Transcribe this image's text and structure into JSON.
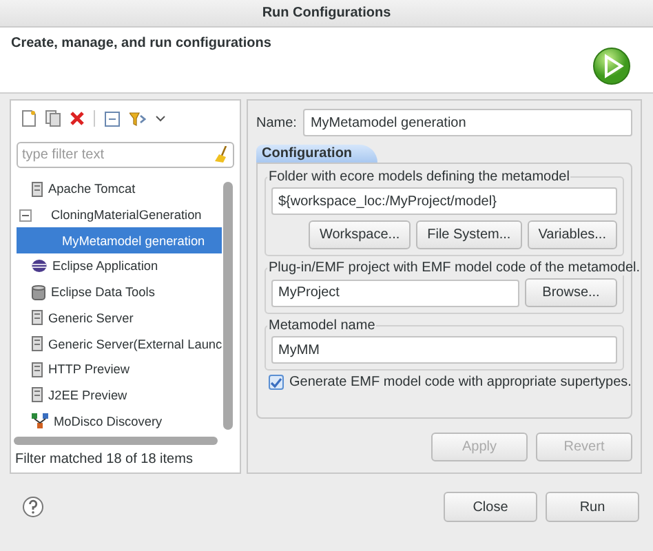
{
  "window": {
    "title": "Run Configurations"
  },
  "header": {
    "message": "Create, manage, and run configurations"
  },
  "sidebar": {
    "filter": {
      "placeholder": "type filter text"
    },
    "tree": [
      {
        "label": "Apache Tomcat",
        "kind": "server",
        "selected": false
      },
      {
        "label": "CloningMaterialGeneration",
        "kind": "group",
        "selected": false,
        "expanded": true,
        "children": [
          {
            "label": "MyMetamodel generation",
            "kind": "config",
            "selected": true
          }
        ]
      },
      {
        "label": "Eclipse Application",
        "kind": "eclipse",
        "selected": false
      },
      {
        "label": "Eclipse Data Tools",
        "kind": "database",
        "selected": false
      },
      {
        "label": "Generic Server",
        "kind": "server",
        "selected": false
      },
      {
        "label": "Generic Server(External Launc",
        "kind": "server",
        "selected": false
      },
      {
        "label": "HTTP Preview",
        "kind": "server",
        "selected": false
      },
      {
        "label": "J2EE Preview",
        "kind": "server",
        "selected": false
      },
      {
        "label": "MoDisco Discovery",
        "kind": "discovery",
        "selected": false
      }
    ],
    "status": "Filter matched 18 of 18 items"
  },
  "editor": {
    "name_label": "Name:",
    "name_value": "MyMetamodel generation",
    "tabs": [
      {
        "label": "Configuration",
        "selected": true
      }
    ],
    "folder_group": {
      "title": "Folder with ecore models defining the metamodel",
      "value": "${workspace_loc:/MyProject/model}",
      "buttons": [
        "Workspace...",
        "File System...",
        "Variables..."
      ]
    },
    "project_group": {
      "title": "Plug-in/EMF project with EMF model code of the metamodel.",
      "value": "MyProject",
      "button": "Browse..."
    },
    "metamodel_group": {
      "title": "Metamodel name",
      "value": "MyMM"
    },
    "generate_option": {
      "label": "Generate EMF model code with appropriate supertypes.",
      "checked": true
    },
    "actions": [
      {
        "label": "Apply",
        "disabled": true
      },
      {
        "label": "Revert",
        "disabled": true
      }
    ]
  },
  "footer": {
    "buttons": [
      {
        "label": "Close"
      },
      {
        "label": "Run"
      }
    ]
  }
}
